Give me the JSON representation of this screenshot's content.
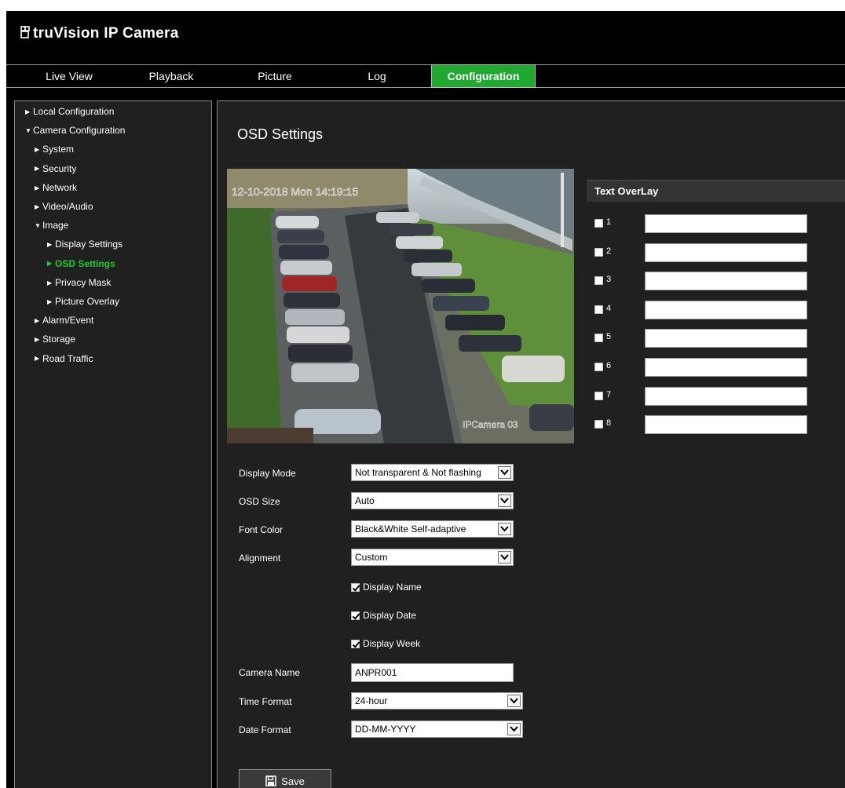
{
  "brand": {
    "name": "truVision IP Camera"
  },
  "nav": {
    "items": [
      {
        "label": "Live View"
      },
      {
        "label": "Playback"
      },
      {
        "label": "Picture"
      },
      {
        "label": "Log"
      },
      {
        "label": "Configuration",
        "active": true
      }
    ]
  },
  "sidebar": {
    "items": [
      {
        "label": "Local Configuration",
        "level": 0,
        "expanded": false
      },
      {
        "label": "Camera Configuration",
        "level": 0,
        "expanded": true
      },
      {
        "label": "System",
        "level": 1,
        "expanded": false
      },
      {
        "label": "Security",
        "level": 1,
        "expanded": false
      },
      {
        "label": "Network",
        "level": 1,
        "expanded": false
      },
      {
        "label": "Video/Audio",
        "level": 1,
        "expanded": false
      },
      {
        "label": "Image",
        "level": 1,
        "expanded": true
      },
      {
        "label": "Display Settings",
        "level": 2,
        "expanded": false
      },
      {
        "label": "OSD Settings",
        "level": 2,
        "expanded": false,
        "active": true
      },
      {
        "label": "Privacy Mask",
        "level": 2,
        "expanded": false
      },
      {
        "label": "Picture Overlay",
        "level": 2,
        "expanded": false
      },
      {
        "label": "Alarm/Event",
        "level": 1,
        "expanded": false
      },
      {
        "label": "Storage",
        "level": 1,
        "expanded": false
      },
      {
        "label": "Road Traffic",
        "level": 1,
        "expanded": false
      }
    ]
  },
  "page": {
    "title": "OSD Settings"
  },
  "preview": {
    "date_overlay": "12-10-2018 Mon 14:19:15",
    "camera_name_overlay": "IPCamera 03"
  },
  "form": {
    "display_mode": {
      "label": "Display Mode",
      "value": "Not transparent & Not flashing"
    },
    "osd_size": {
      "label": "OSD Size",
      "value": "Auto"
    },
    "font_color": {
      "label": "Font Color",
      "value": "Black&White Self-adaptive"
    },
    "alignment": {
      "label": "Alignment",
      "value": "Custom"
    },
    "display_name": {
      "label": "Display Name",
      "checked": true
    },
    "display_date": {
      "label": "Display Date",
      "checked": true
    },
    "display_week": {
      "label": "Display Week",
      "checked": true
    },
    "camera_name": {
      "label": "Camera Name",
      "value": "ANPR001"
    },
    "time_format": {
      "label": "Time Format",
      "value": "24-hour"
    },
    "date_format": {
      "label": "Date Format",
      "value": "DD-MM-YYYY"
    },
    "save_label": "Save"
  },
  "text_overlay": {
    "title": "Text OverLay",
    "rows": [
      {
        "num": "1",
        "checked": false,
        "value": ""
      },
      {
        "num": "2",
        "checked": false,
        "value": ""
      },
      {
        "num": "3",
        "checked": false,
        "value": ""
      },
      {
        "num": "4",
        "checked": false,
        "value": ""
      },
      {
        "num": "5",
        "checked": false,
        "value": ""
      },
      {
        "num": "6",
        "checked": false,
        "value": ""
      },
      {
        "num": "7",
        "checked": false,
        "value": ""
      },
      {
        "num": "8",
        "checked": false,
        "value": ""
      }
    ]
  },
  "colors": {
    "accent": "#20a830",
    "active_tree": "#22c82e",
    "panel": "#202020"
  }
}
